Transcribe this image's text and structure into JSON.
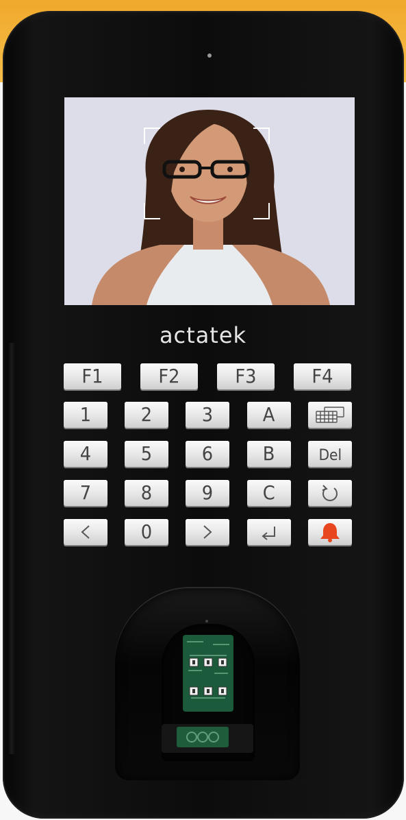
{
  "brand": "actatek",
  "function_keys": [
    "F1",
    "F2",
    "F3",
    "F4"
  ],
  "keypad": [
    [
      "1",
      "2",
      "3",
      "A",
      ""
    ],
    [
      "4",
      "5",
      "6",
      "B",
      "Del"
    ],
    [
      "7",
      "8",
      "9",
      "C",
      ""
    ],
    [
      "",
      "0",
      "",
      "",
      ""
    ]
  ],
  "icons": {
    "keyboard_key": "keyboard-icon",
    "refresh_key": "refresh-icon",
    "left_key": "chevron-left-icon",
    "right_key": "chevron-right-icon",
    "enter_key": "enter-icon",
    "alarm_key": "bell-icon"
  },
  "colors": {
    "device_body": "#0c0c0c",
    "key_face": "#e6e6e6",
    "alarm": "#e8461e",
    "fingerprint_board": "#1e5c3b"
  }
}
